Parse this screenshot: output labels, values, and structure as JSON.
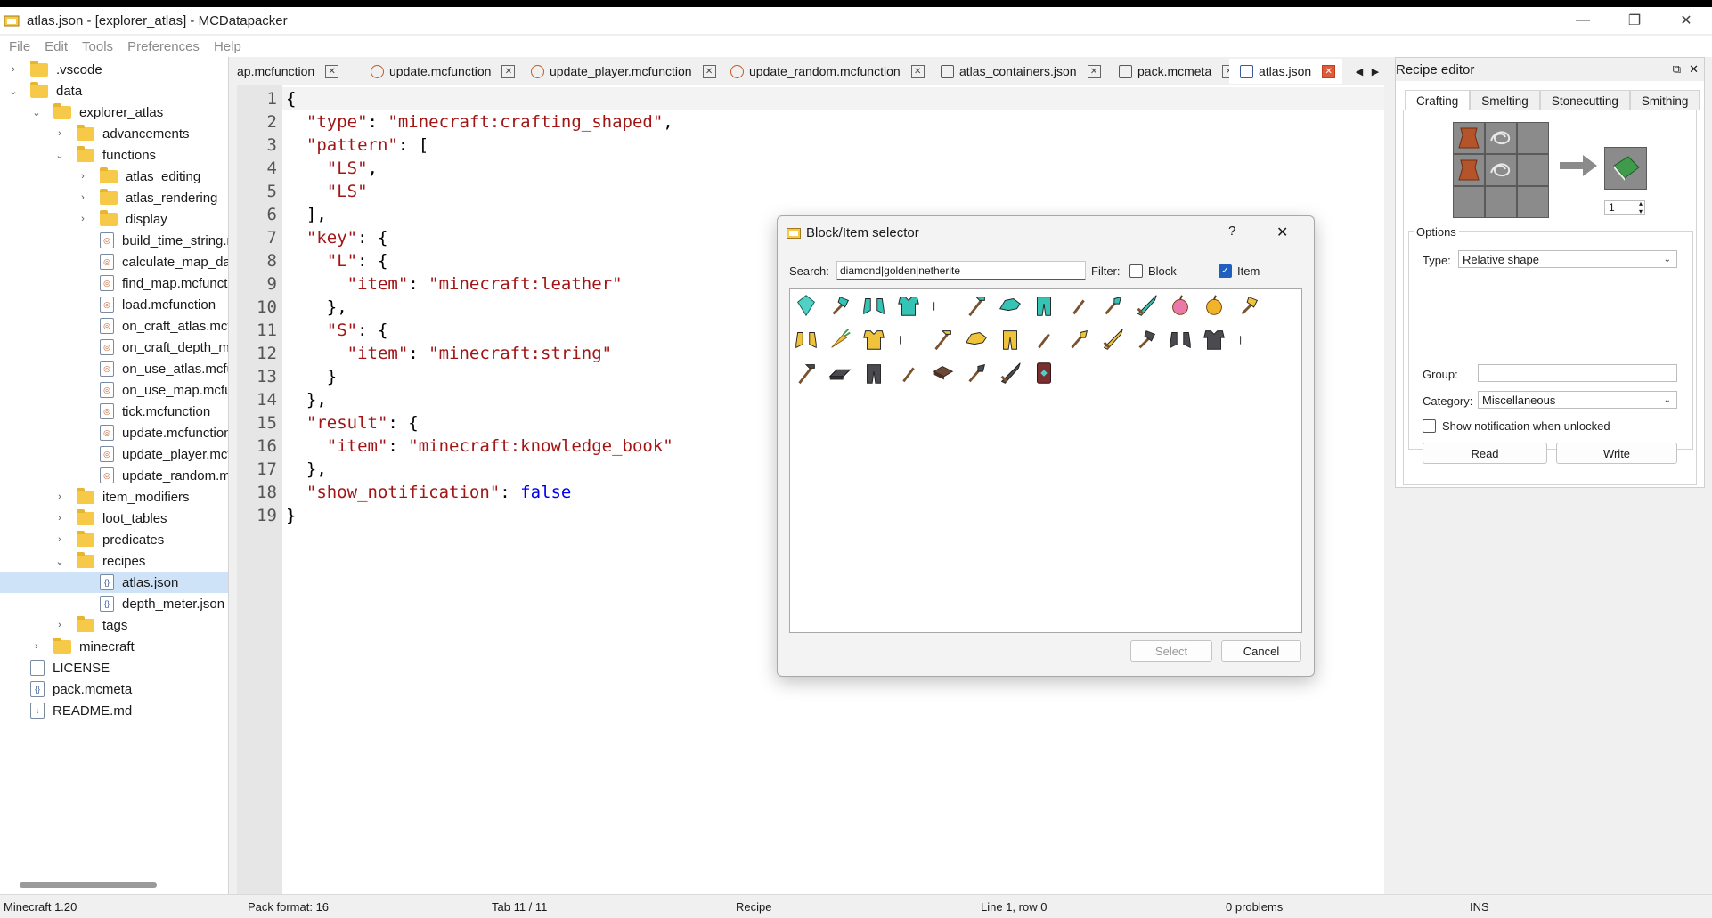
{
  "window": {
    "title": "atlas.json - [explorer_atlas] - MCDatapacker",
    "minimize": "—",
    "maximize": "❐",
    "close": "✕"
  },
  "menu": [
    "File",
    "Edit",
    "Tools",
    "Preferences",
    "Help"
  ],
  "tree": {
    "rows": [
      {
        "label": ".vscode",
        "type": "folder",
        "arrow": "›"
      },
      {
        "label": "data",
        "type": "folder",
        "arrow": "⌄"
      },
      {
        "label": "explorer_atlas",
        "type": "folder",
        "arrow": "⌄"
      },
      {
        "label": "advancements",
        "type": "folder",
        "arrow": "›"
      },
      {
        "label": "functions",
        "type": "folder",
        "arrow": "⌄"
      },
      {
        "label": "atlas_editing",
        "type": "folder",
        "arrow": "›"
      },
      {
        "label": "atlas_rendering",
        "type": "folder",
        "arrow": "›"
      },
      {
        "label": "display",
        "type": "folder",
        "arrow": "›"
      },
      {
        "label": "build_time_string.m",
        "type": "mcfunction"
      },
      {
        "label": "calculate_map_data",
        "type": "mcfunction"
      },
      {
        "label": "find_map.mcfunctio",
        "type": "mcfunction"
      },
      {
        "label": "load.mcfunction",
        "type": "mcfunction"
      },
      {
        "label": "on_craft_atlas.mcfur",
        "type": "mcfunction"
      },
      {
        "label": "on_craft_depth_met",
        "type": "mcfunction"
      },
      {
        "label": "on_use_atlas.mcfunc",
        "type": "mcfunction"
      },
      {
        "label": "on_use_map.mcfunct",
        "type": "mcfunction"
      },
      {
        "label": "tick.mcfunction",
        "type": "mcfunction"
      },
      {
        "label": "update.mcfunction",
        "type": "mcfunction"
      },
      {
        "label": "update_player.mcfu",
        "type": "mcfunction"
      },
      {
        "label": "update_random.mc",
        "type": "mcfunction"
      },
      {
        "label": "item_modifiers",
        "type": "folder",
        "arrow": "›"
      },
      {
        "label": "loot_tables",
        "type": "folder",
        "arrow": "›"
      },
      {
        "label": "predicates",
        "type": "folder",
        "arrow": "›"
      },
      {
        "label": "recipes",
        "type": "folder",
        "arrow": "⌄"
      },
      {
        "label": "atlas.json",
        "type": "json",
        "selected": true
      },
      {
        "label": "depth_meter.json",
        "type": "json"
      },
      {
        "label": "tags",
        "type": "folder",
        "arrow": "›"
      },
      {
        "label": "minecraft",
        "type": "folder",
        "arrow": "›"
      },
      {
        "label": "LICENSE",
        "type": "file"
      },
      {
        "label": "pack.mcmeta",
        "type": "json"
      },
      {
        "label": "README.md",
        "type": "md"
      }
    ]
  },
  "tabs": [
    {
      "label": "ap.mcfunction",
      "kind": "mcfunction"
    },
    {
      "label": "update.mcfunction",
      "kind": "mcfunction"
    },
    {
      "label": "update_player.mcfunction",
      "kind": "mcfunction"
    },
    {
      "label": "update_random.mcfunction",
      "kind": "mcfunction"
    },
    {
      "label": "atlas_containers.json",
      "kind": "json"
    },
    {
      "label": "pack.mcmeta",
      "kind": "json"
    },
    {
      "label": "atlas.json",
      "kind": "json",
      "active": true
    }
  ],
  "tab_nav": {
    "prev": "◀",
    "next": "▶"
  },
  "editor": {
    "lines": [
      [
        {
          "t": "{",
          "c": ""
        }
      ],
      [
        {
          "t": "  ",
          "c": ""
        },
        {
          "t": "\"type\"",
          "c": "s"
        },
        {
          "t": ": ",
          "c": ""
        },
        {
          "t": "\"minecraft:crafting_shaped\"",
          "c": "s"
        },
        {
          "t": ",",
          "c": ""
        }
      ],
      [
        {
          "t": "  ",
          "c": ""
        },
        {
          "t": "\"pattern\"",
          "c": "s"
        },
        {
          "t": ": [",
          "c": ""
        }
      ],
      [
        {
          "t": "    ",
          "c": ""
        },
        {
          "t": "\"LS\"",
          "c": "s"
        },
        {
          "t": ",",
          "c": ""
        }
      ],
      [
        {
          "t": "    ",
          "c": ""
        },
        {
          "t": "\"LS\"",
          "c": "s"
        }
      ],
      [
        {
          "t": "  ],",
          "c": ""
        }
      ],
      [
        {
          "t": "  ",
          "c": ""
        },
        {
          "t": "\"key\"",
          "c": "s"
        },
        {
          "t": ": {",
          "c": ""
        }
      ],
      [
        {
          "t": "    ",
          "c": ""
        },
        {
          "t": "\"L\"",
          "c": "s"
        },
        {
          "t": ": {",
          "c": ""
        }
      ],
      [
        {
          "t": "      ",
          "c": ""
        },
        {
          "t": "\"item\"",
          "c": "s"
        },
        {
          "t": ": ",
          "c": ""
        },
        {
          "t": "\"minecraft:leather\"",
          "c": "s"
        }
      ],
      [
        {
          "t": "    },",
          "c": ""
        }
      ],
      [
        {
          "t": "    ",
          "c": ""
        },
        {
          "t": "\"S\"",
          "c": "s"
        },
        {
          "t": ": {",
          "c": ""
        }
      ],
      [
        {
          "t": "      ",
          "c": ""
        },
        {
          "t": "\"item\"",
          "c": "s"
        },
        {
          "t": ": ",
          "c": ""
        },
        {
          "t": "\"minecraft:string\"",
          "c": "s"
        }
      ],
      [
        {
          "t": "    }",
          "c": ""
        }
      ],
      [
        {
          "t": "  },",
          "c": ""
        }
      ],
      [
        {
          "t": "  ",
          "c": ""
        },
        {
          "t": "\"result\"",
          "c": "s"
        },
        {
          "t": ": {",
          "c": ""
        }
      ],
      [
        {
          "t": "    ",
          "c": ""
        },
        {
          "t": "\"item\"",
          "c": "s"
        },
        {
          "t": ": ",
          "c": ""
        },
        {
          "t": "\"minecraft:knowledge_book\"",
          "c": "s"
        }
      ],
      [
        {
          "t": "  },",
          "c": ""
        }
      ],
      [
        {
          "t": "  ",
          "c": ""
        },
        {
          "t": "\"show_notification\"",
          "c": "s"
        },
        {
          "t": ": ",
          "c": ""
        },
        {
          "t": "false",
          "c": "k"
        }
      ],
      [
        {
          "t": "}",
          "c": ""
        }
      ]
    ]
  },
  "recipe_editor": {
    "title": "Recipe editor",
    "float_icon": "⧉",
    "close_icon": "✕",
    "tabs": [
      "Crafting",
      "Smelting",
      "Stonecutting",
      "Smithing"
    ],
    "result_count": "1",
    "options_label": "Options",
    "type_label": "Type:",
    "type_value": "Relative shape",
    "group_label": "Group:",
    "group_value": "",
    "category_label": "Category:",
    "category_value": "Miscellaneous",
    "notify_label": "Show notification when unlocked",
    "read_button": "Read",
    "write_button": "Write"
  },
  "dialog": {
    "title": "Block/Item selector",
    "help": "?",
    "close": "✕",
    "search_label": "Search:",
    "search_value": "diamond|golden|netherite",
    "filter_label": "Filter:",
    "block_label": "Block",
    "item_label": "Item",
    "block_checked": false,
    "item_checked": true,
    "select_button": "Select",
    "cancel_button": "Cancel",
    "items": [
      {
        "name": "diamond-icon",
        "color": "#4fd1c5",
        "shape": "gem"
      },
      {
        "name": "diamond-axe-icon",
        "color": "#35c3b6",
        "shape": "axe"
      },
      {
        "name": "diamond-boots-icon",
        "color": "#35c3b6",
        "shape": "boots"
      },
      {
        "name": "diamond-chestplate-icon",
        "color": "#35c3b6",
        "shape": "chest"
      },
      {
        "name": "diamond-helmet-icon",
        "color": "#35c3b6",
        "shape": "helmet"
      },
      {
        "name": "diamond-hoe-icon",
        "color": "#35c3b6",
        "shape": "hoe"
      },
      {
        "name": "diamond-horse-armor-icon",
        "color": "#35c3b6",
        "shape": "horse"
      },
      {
        "name": "diamond-leggings-icon",
        "color": "#35c3b6",
        "shape": "legs"
      },
      {
        "name": "diamond-pickaxe-icon",
        "color": "#35c3b6",
        "shape": "pick"
      },
      {
        "name": "diamond-shovel-icon",
        "color": "#35c3b6",
        "shape": "shovel"
      },
      {
        "name": "diamond-sword-icon",
        "color": "#35c3b6",
        "shape": "sword"
      },
      {
        "name": "enchanted-golden-apple-icon",
        "color": "#e879a8",
        "shape": "apple"
      },
      {
        "name": "golden-apple-icon",
        "color": "#f0b429",
        "shape": "apple"
      },
      {
        "name": "golden-axe-icon",
        "color": "#f0c33c",
        "shape": "axe"
      },
      {
        "name": "golden-boots-icon",
        "color": "#f0c33c",
        "shape": "boots"
      },
      {
        "name": "golden-carrot-icon",
        "color": "#f0c33c",
        "shape": "carrot"
      },
      {
        "name": "golden-chestplate-icon",
        "color": "#f0c33c",
        "shape": "chest"
      },
      {
        "name": "golden-helmet-icon",
        "color": "#f0c33c",
        "shape": "helmet"
      },
      {
        "name": "golden-hoe-icon",
        "color": "#f0c33c",
        "shape": "hoe"
      },
      {
        "name": "golden-horse-armor-icon",
        "color": "#f0c33c",
        "shape": "horse"
      },
      {
        "name": "golden-leggings-icon",
        "color": "#f0c33c",
        "shape": "legs"
      },
      {
        "name": "golden-pickaxe-icon",
        "color": "#f0c33c",
        "shape": "pick"
      },
      {
        "name": "golden-shovel-icon",
        "color": "#f0c33c",
        "shape": "shovel"
      },
      {
        "name": "golden-sword-icon",
        "color": "#f0c33c",
        "shape": "sword"
      },
      {
        "name": "netherite-axe-icon",
        "color": "#4a4a50",
        "shape": "axe"
      },
      {
        "name": "netherite-boots-icon",
        "color": "#4a4a50",
        "shape": "boots"
      },
      {
        "name": "netherite-chestplate-icon",
        "color": "#4a4a50",
        "shape": "chest"
      },
      {
        "name": "netherite-helmet-icon",
        "color": "#4a4a50",
        "shape": "helmet"
      },
      {
        "name": "netherite-hoe-icon",
        "color": "#4a4a50",
        "shape": "hoe"
      },
      {
        "name": "netherite-ingot-icon",
        "color": "#4a4a50",
        "shape": "ingot"
      },
      {
        "name": "netherite-leggings-icon",
        "color": "#4a4a50",
        "shape": "legs"
      },
      {
        "name": "netherite-pickaxe-icon",
        "color": "#4a4a50",
        "shape": "pick"
      },
      {
        "name": "netherite-scrap-icon",
        "color": "#6b4a3a",
        "shape": "scrap"
      },
      {
        "name": "netherite-shovel-icon",
        "color": "#4a4a50",
        "shape": "shovel"
      },
      {
        "name": "netherite-sword-icon",
        "color": "#4a4a50",
        "shape": "sword"
      },
      {
        "name": "netherite-upgrade-template-icon",
        "color": "#7a3030",
        "shape": "template"
      }
    ]
  },
  "status": {
    "version": "Minecraft 1.20",
    "pack_format": "Pack format: 16",
    "tab": "Tab 11 / 11",
    "type": "Recipe",
    "position": "Line 1, row 0",
    "problems": "0 problems",
    "mode": "INS"
  }
}
